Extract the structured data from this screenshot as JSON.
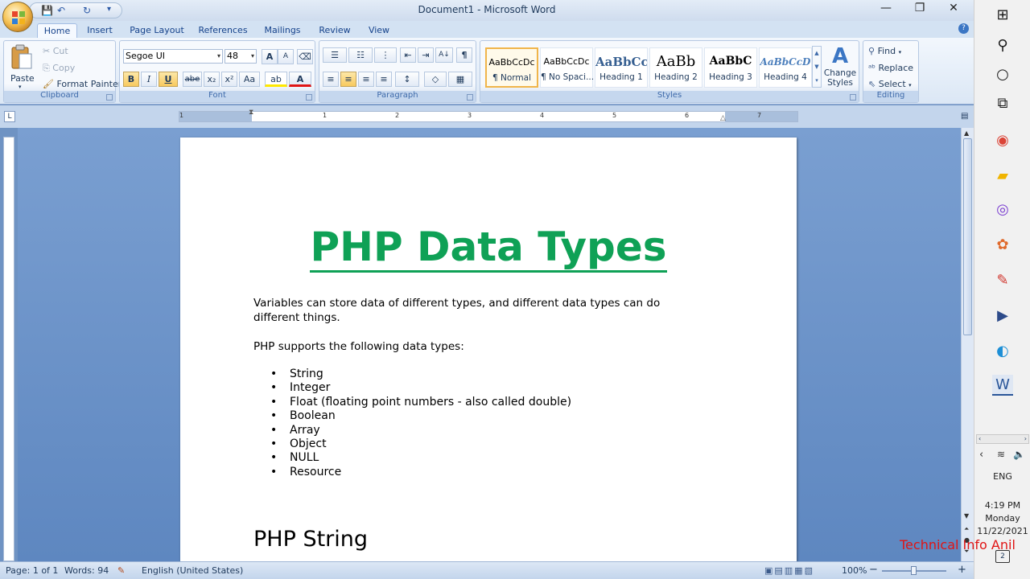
{
  "window": {
    "title": "Document1 - Microsoft Word",
    "minimize": "—",
    "restore": "❐",
    "close": "✕"
  },
  "qat": {
    "save": "💾",
    "undo": "↶",
    "redo": "↻",
    "customize": "▾"
  },
  "tabs": [
    "Home",
    "Insert",
    "Page Layout",
    "References",
    "Mailings",
    "Review",
    "View"
  ],
  "help_glyph": "?",
  "clipboard": {
    "paste": "Paste",
    "cut": "Cut",
    "copy": "Copy",
    "format_painter": "Format Painter",
    "label": "Clipboard"
  },
  "font": {
    "name": "Segoe UI",
    "size": "48",
    "label": "Font",
    "grow": "A",
    "shrink": "A",
    "clear": "⌫",
    "bold": "B",
    "italic": "I",
    "underline": "U",
    "strike": "abe",
    "sub": "x₂",
    "sup": "x²",
    "case": "Aa",
    "highlight": "ab",
    "color": "A"
  },
  "paragraph": {
    "label": "Paragraph",
    "pilcrow": "¶",
    "sort": "A↓",
    "bullets": "☰",
    "numbering": "☷",
    "multilevel": "⋮",
    "dec_indent": "⇤",
    "inc_indent": "⇥",
    "align_left": "≡",
    "align_center": "≡",
    "align_right": "≡",
    "justify": "≡",
    "line_spacing": "↕",
    "shading": "◇",
    "borders": "▦"
  },
  "styles": {
    "label": "Styles",
    "items": [
      {
        "sample": "AaBbCcDc",
        "name": "¶ Normal"
      },
      {
        "sample": "AaBbCcDc",
        "name": "¶ No Spaci..."
      },
      {
        "sample": "AaBbCc",
        "name": "Heading 1"
      },
      {
        "sample": "AaBb",
        "name": "Heading 2"
      },
      {
        "sample": "AaBbC",
        "name": "Heading 3"
      },
      {
        "sample": "AaBbCcD",
        "name": "Heading 4"
      }
    ],
    "change_styles": "Change Styles"
  },
  "editing": {
    "find": "Find",
    "replace": "Replace",
    "select": "Select",
    "label": "Editing"
  },
  "ruler": {
    "numbers": [
      "1",
      "1",
      "2",
      "3",
      "4",
      "5",
      "6",
      "7"
    ],
    "tab_selector": "L"
  },
  "document": {
    "title": "PHP Data Types",
    "para1": "Variables can store data of different types, and different data types can do different things.",
    "para2": "PHP supports the following data types:",
    "bullets": [
      "String",
      "Integer",
      "Float (floating point numbers - also called double)",
      "Boolean",
      "Array",
      "Object",
      "NULL",
      "Resource"
    ],
    "subheading": "PHP String"
  },
  "status": {
    "page": "Page: 1 of 1",
    "words": "Words: 94",
    "language": "English (United States)",
    "zoom": "100%",
    "zoom_out": "−",
    "zoom_in": "+"
  },
  "taskbar": {
    "language": "ENG",
    "time": "4:19 PM",
    "day": "Monday",
    "date": "11/22/2021",
    "notifications": "2"
  },
  "watermark": "Technical Info Anil",
  "colors": {
    "title_green": "#0fa156",
    "ribbon_blue": "#15428b",
    "watermark_red": "#e01414"
  }
}
